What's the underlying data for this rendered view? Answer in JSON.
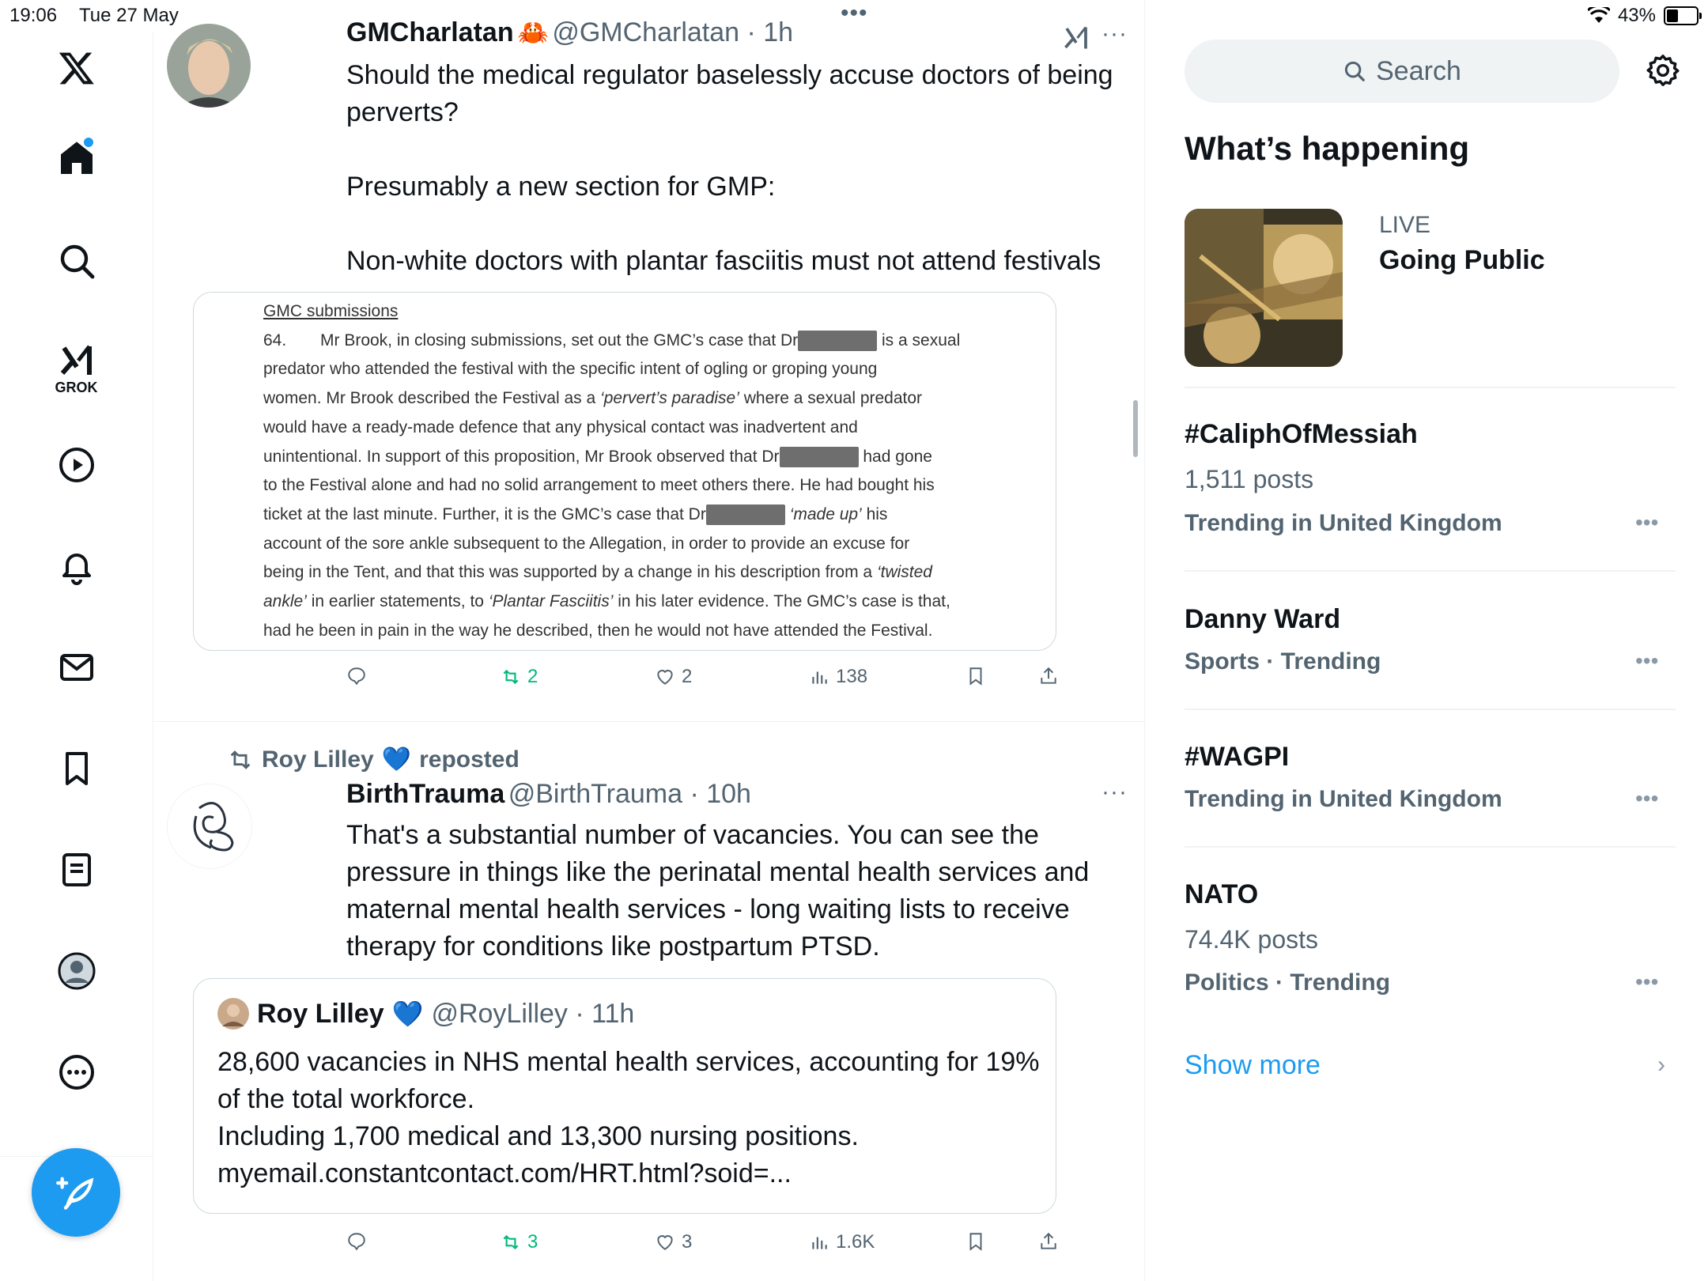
{
  "status_bar": {
    "time": "19:06",
    "date": "Tue 27 May",
    "battery": "43%"
  },
  "tweets": [
    {
      "display_name": "GMCharlatan",
      "name_emoji": "🦀",
      "handle_time": "@GMCharlatan · 1h",
      "text": "Should the medical regulator baselessly accuse doctors of being perverts?\n\nPresumably a new section for GMP:\n\nNon-white doctors with plantar fasciitis must not attend festivals",
      "image_doc": {
        "heading": "GMC submissions",
        "para_num": "64.",
        "line1_a": "Mr Brook, in closing submissions, set out the GMC’s case that Dr",
        "line1_b": "is a sexual",
        "line2": "predator who attended the festival with the specific intent of ogling or groping young",
        "line3_a": "women. Mr Brook described the Festival as a",
        "line3_i": "‘pervert’s paradise’",
        "line3_b": "where a sexual predator",
        "line4": "would have a ready-made defence that any physical contact was inadvertent and",
        "line5_a": "unintentional. In support of this proposition, Mr Brook observed that Dr",
        "line5_b": "had gone",
        "line6": "to the Festival alone and had no solid arrangement to meet others there. He had bought his",
        "line7_a": "ticket at the last minute. Further, it is the GMC’s case that Dr",
        "line7_i": "‘made up’",
        "line7_b": "his",
        "line8": "account of the sore ankle subsequent to the Allegation, in order to provide an excuse for",
        "line9_a": "being in the Tent, and that this was supported by a change in his description from a",
        "line9_i": "‘twisted",
        "line10_i": "ankle’",
        "line10_a": "in earlier statements, to",
        "line10_i2": "‘Plantar Fasciitis’",
        "line10_b": "in his later evidence. The GMC’s case is that,",
        "line11": "had he been in pain in the way he described, then he would not have attended the Festival."
      },
      "stats": {
        "replies": "",
        "reposts": "2",
        "likes": "2",
        "views": "138"
      }
    },
    {
      "repost_by": "Roy Lilley",
      "repost_emoji": "💙",
      "repost_label": "reposted",
      "display_name": "BirthTrauma",
      "handle_time": "@BirthTrauma · 10h",
      "text": "That's a substantial number of vacancies. You can see the pressure in things like the perinatal mental health services and maternal mental health services - long waiting lists to receive therapy for conditions like postpartum PTSD.",
      "quote": {
        "display_name": "Roy Lilley",
        "name_emoji": "💙",
        "handle_time": "@RoyLilley · 11h",
        "text": "28,600 vacancies in NHS mental health services, accounting for 19% of the total workforce.\nIncluding 1,700 medical and 13,300 nursing positions.\nmyemail.constantcontact.com/HRT.html?soid=..."
      },
      "stats": {
        "replies": "",
        "reposts": "3",
        "likes": "3",
        "views": "1.6K"
      }
    }
  ],
  "nav": {
    "grok_label": "GROK"
  },
  "sidebar": {
    "search_placeholder": "Search",
    "section_title": "What’s happening",
    "live": {
      "label": "LIVE",
      "title": "Going Public"
    },
    "trends": [
      {
        "title": "#CaliphOfMessiah",
        "posts": "1,511 posts",
        "meta": "Trending in United Kingdom"
      },
      {
        "title": "Danny Ward",
        "posts": "",
        "meta": "Sports · Trending"
      },
      {
        "title": "#WAGPI",
        "posts": "",
        "meta": "Trending in United Kingdom"
      },
      {
        "title": "NATO",
        "posts": "74.4K posts",
        "meta": "Politics · Trending"
      }
    ],
    "show_more": "Show more"
  },
  "colors": {
    "accent": "#1d9bf0",
    "repost_green": "#00ba7c",
    "secondary_text": "#536471"
  }
}
